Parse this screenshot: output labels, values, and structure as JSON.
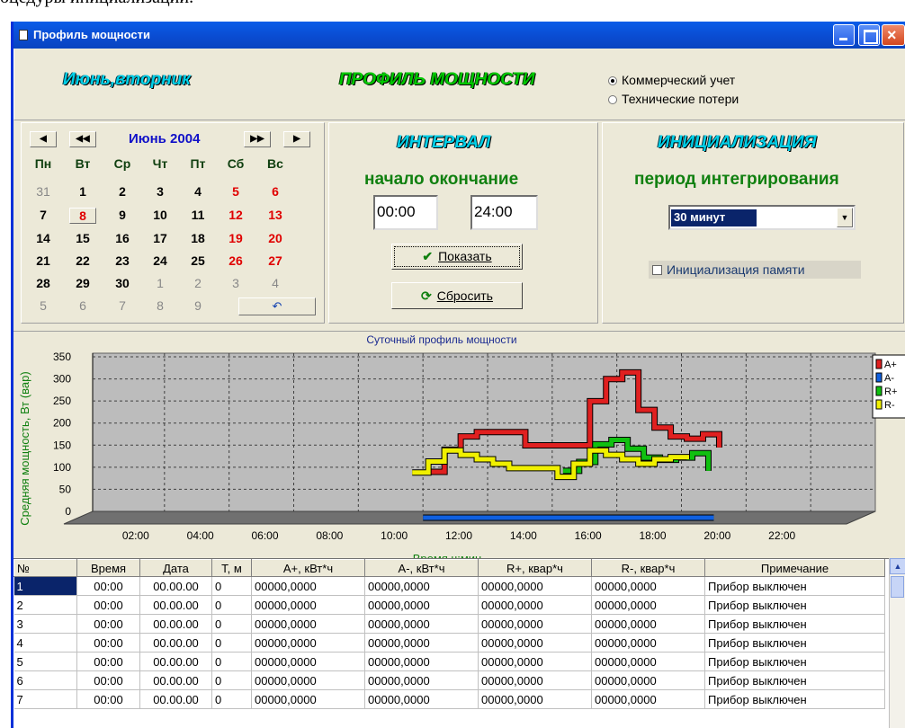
{
  "doc_line": "оцедуры инициализации.",
  "window": {
    "title": "Профиль мощности"
  },
  "header": {
    "date_label": "Июнь,вторник",
    "main_title": "ПРОФИЛЬ МОЩНОСТИ",
    "mode_options": [
      "Коммерческий учет",
      "Технические потери"
    ],
    "mode_selected": 0
  },
  "calendar": {
    "month_title": "Июнь 2004",
    "nav": [
      "◀",
      "◀◀",
      "▶▶",
      "▶"
    ],
    "weekdays": [
      "Пн",
      "Вт",
      "Ср",
      "Чт",
      "Пт",
      "Сб",
      "Вс"
    ],
    "rows": [
      [
        "31",
        "1",
        "2",
        "3",
        "4",
        "5",
        "6"
      ],
      [
        "7",
        "8",
        "9",
        "10",
        "11",
        "12",
        "13"
      ],
      [
        "14",
        "15",
        "16",
        "17",
        "18",
        "19",
        "20"
      ],
      [
        "21",
        "22",
        "23",
        "24",
        "25",
        "26",
        "27"
      ],
      [
        "28",
        "29",
        "30",
        "1",
        "2",
        "3",
        "4"
      ],
      [
        "5",
        "6",
        "7",
        "8",
        "9"
      ]
    ],
    "undo_icon": "↶"
  },
  "interval": {
    "title": "ИНТЕРВАЛ",
    "subtitle": "начало окончание",
    "start": "00:00",
    "end": "24:00",
    "show_button": "Показать",
    "reset_button": "Сбросить"
  },
  "init": {
    "title": "ИНИЦИАЛИЗАЦИЯ",
    "subtitle": "период интегрирования",
    "period_selected": "30 минут",
    "memory_init_label": "Инициализация памяти",
    "memory_init_checked": false
  },
  "chart_data": {
    "type": "line",
    "title": "Суточный профиль мощности",
    "xlabel": "Время ч:мин",
    "ylabel": "Средняя мощность, Вт (вар)",
    "x_ticks": [
      "02:00",
      "04:00",
      "06:00",
      "08:00",
      "10:00",
      "12:00",
      "14:00",
      "16:00",
      "18:00",
      "20:00",
      "22:00"
    ],
    "y_ticks": [
      "0",
      "50",
      "100",
      "150",
      "200",
      "250",
      "300",
      "350"
    ],
    "ylim": [
      0,
      350
    ],
    "legend": [
      "A+",
      "A-",
      "R+",
      "R-"
    ],
    "legend_position": "right",
    "colors": {
      "A+": "#e02020",
      "A-": "#1060e0",
      "R+": "#10c010",
      "R-": "#f0f000"
    },
    "series": [
      {
        "name": "A+",
        "x": [
          9.5,
          10.0,
          10.5,
          11.0,
          11.5,
          12.0,
          12.5,
          14.5,
          15.0,
          15.5,
          16.0,
          16.5,
          17.0,
          17.5,
          18.0,
          18.5
        ],
        "values": [
          110,
          160,
          190,
          200,
          200,
          200,
          170,
          270,
          320,
          335,
          250,
          210,
          190,
          185,
          195,
          165
        ]
      },
      {
        "name": "A-",
        "x": [
          9.5,
          12.5,
          14.0,
          18.5
        ],
        "values": [
          0,
          0,
          0,
          0
        ]
      },
      {
        "name": "R+",
        "x": [
          14.0,
          14.5,
          15.0,
          15.5,
          16.0,
          16.5,
          17.0,
          17.5,
          18.0,
          18.5
        ],
        "values": [
          100,
          120,
          160,
          170,
          150,
          130,
          125,
          130,
          140,
          100
        ]
      },
      {
        "name": "R-",
        "x": [
          9.5,
          10.0,
          10.5,
          11.0,
          11.5,
          12.0,
          12.5,
          14.0,
          14.5,
          15.0,
          15.5,
          16.0,
          16.5,
          17.0,
          17.5,
          18.0
        ],
        "values": [
          90,
          115,
          140,
          130,
          120,
          110,
          100,
          80,
          110,
          140,
          130,
          120,
          110,
          120,
          125,
          120
        ]
      }
    ]
  },
  "table": {
    "columns": [
      "№",
      "Время",
      "Дата",
      "Т, м",
      "А+, кВт*ч",
      "А-, кВт*ч",
      "R+, квар*ч",
      "R-, квар*ч",
      "Примечание"
    ],
    "rows": [
      [
        "1",
        "00:00",
        "00.00.00",
        "0",
        "00000,0000",
        "00000,0000",
        "00000,0000",
        "00000,0000",
        "Прибор выключен"
      ],
      [
        "2",
        "00:00",
        "00.00.00",
        "0",
        "00000,0000",
        "00000,0000",
        "00000,0000",
        "00000,0000",
        "Прибор выключен"
      ],
      [
        "3",
        "00:00",
        "00.00.00",
        "0",
        "00000,0000",
        "00000,0000",
        "00000,0000",
        "00000,0000",
        "Прибор выключен"
      ],
      [
        "4",
        "00:00",
        "00.00.00",
        "0",
        "00000,0000",
        "00000,0000",
        "00000,0000",
        "00000,0000",
        "Прибор выключен"
      ],
      [
        "5",
        "00:00",
        "00.00.00",
        "0",
        "00000,0000",
        "00000,0000",
        "00000,0000",
        "00000,0000",
        "Прибор выключен"
      ],
      [
        "6",
        "00:00",
        "00.00.00",
        "0",
        "00000,0000",
        "00000,0000",
        "00000,0000",
        "00000,0000",
        "Прибор выключен"
      ],
      [
        "7",
        "00:00",
        "00.00.00",
        "0",
        "00000,0000",
        "00000,0000",
        "00000,0000",
        "00000,0000",
        "Прибор выключен"
      ]
    ]
  }
}
